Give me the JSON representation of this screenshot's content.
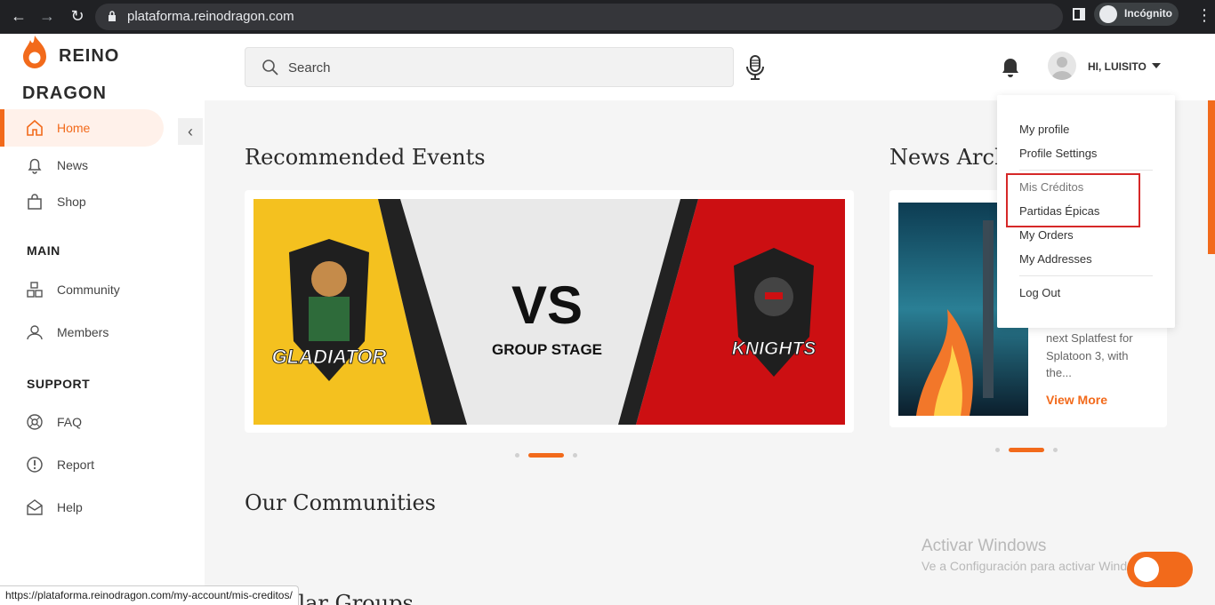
{
  "browser": {
    "url": "plataforma.reinodragon.com",
    "profile_label": "Incógnito",
    "status_url": "https://plataforma.reinodragon.com/my-account/mis-creditos/"
  },
  "brand": {
    "line1": "REINO",
    "line2": "DRAGON",
    "accent": "#f26a1b"
  },
  "sidebar": {
    "items": [
      {
        "label": "Home",
        "icon": "home-icon",
        "active": true
      },
      {
        "label": "News",
        "icon": "bell-icon"
      },
      {
        "label": "Shop",
        "icon": "shop-icon"
      }
    ],
    "main_title": "MAIN",
    "main_items": [
      {
        "label": "Community",
        "icon": "community-icon"
      },
      {
        "label": "Members",
        "icon": "members-icon"
      }
    ],
    "support_title": "SUPPORT",
    "support_items": [
      {
        "label": "FAQ",
        "icon": "faq-icon"
      },
      {
        "label": "Report",
        "icon": "report-icon"
      },
      {
        "label": "Help",
        "icon": "help-icon"
      }
    ]
  },
  "header": {
    "search_placeholder": "Search",
    "greeting": "HI, LUISITO"
  },
  "main": {
    "recommended_title": "Recommended Events",
    "news_title": "News Archive",
    "communities_title": "Our Communities",
    "groups_title": "Popular Groups",
    "event_banner": {
      "left_team": "GLADIATOR",
      "vs": "VS",
      "stage": "GROUP STAGE",
      "right_team": "KNIGHTS"
    },
    "news_excerpt": "next Splatfest for Splatoon 3, with the...",
    "view_more": "View More"
  },
  "dropdown": {
    "items": [
      "My profile",
      "Profile Settings",
      "Mis Créditos",
      "Partidas Épicas",
      "My Orders",
      "My Addresses",
      "Log Out"
    ]
  },
  "watermark": {
    "line1": "Activar Windows",
    "line2": "Ve a Configuración para activar Windows."
  }
}
